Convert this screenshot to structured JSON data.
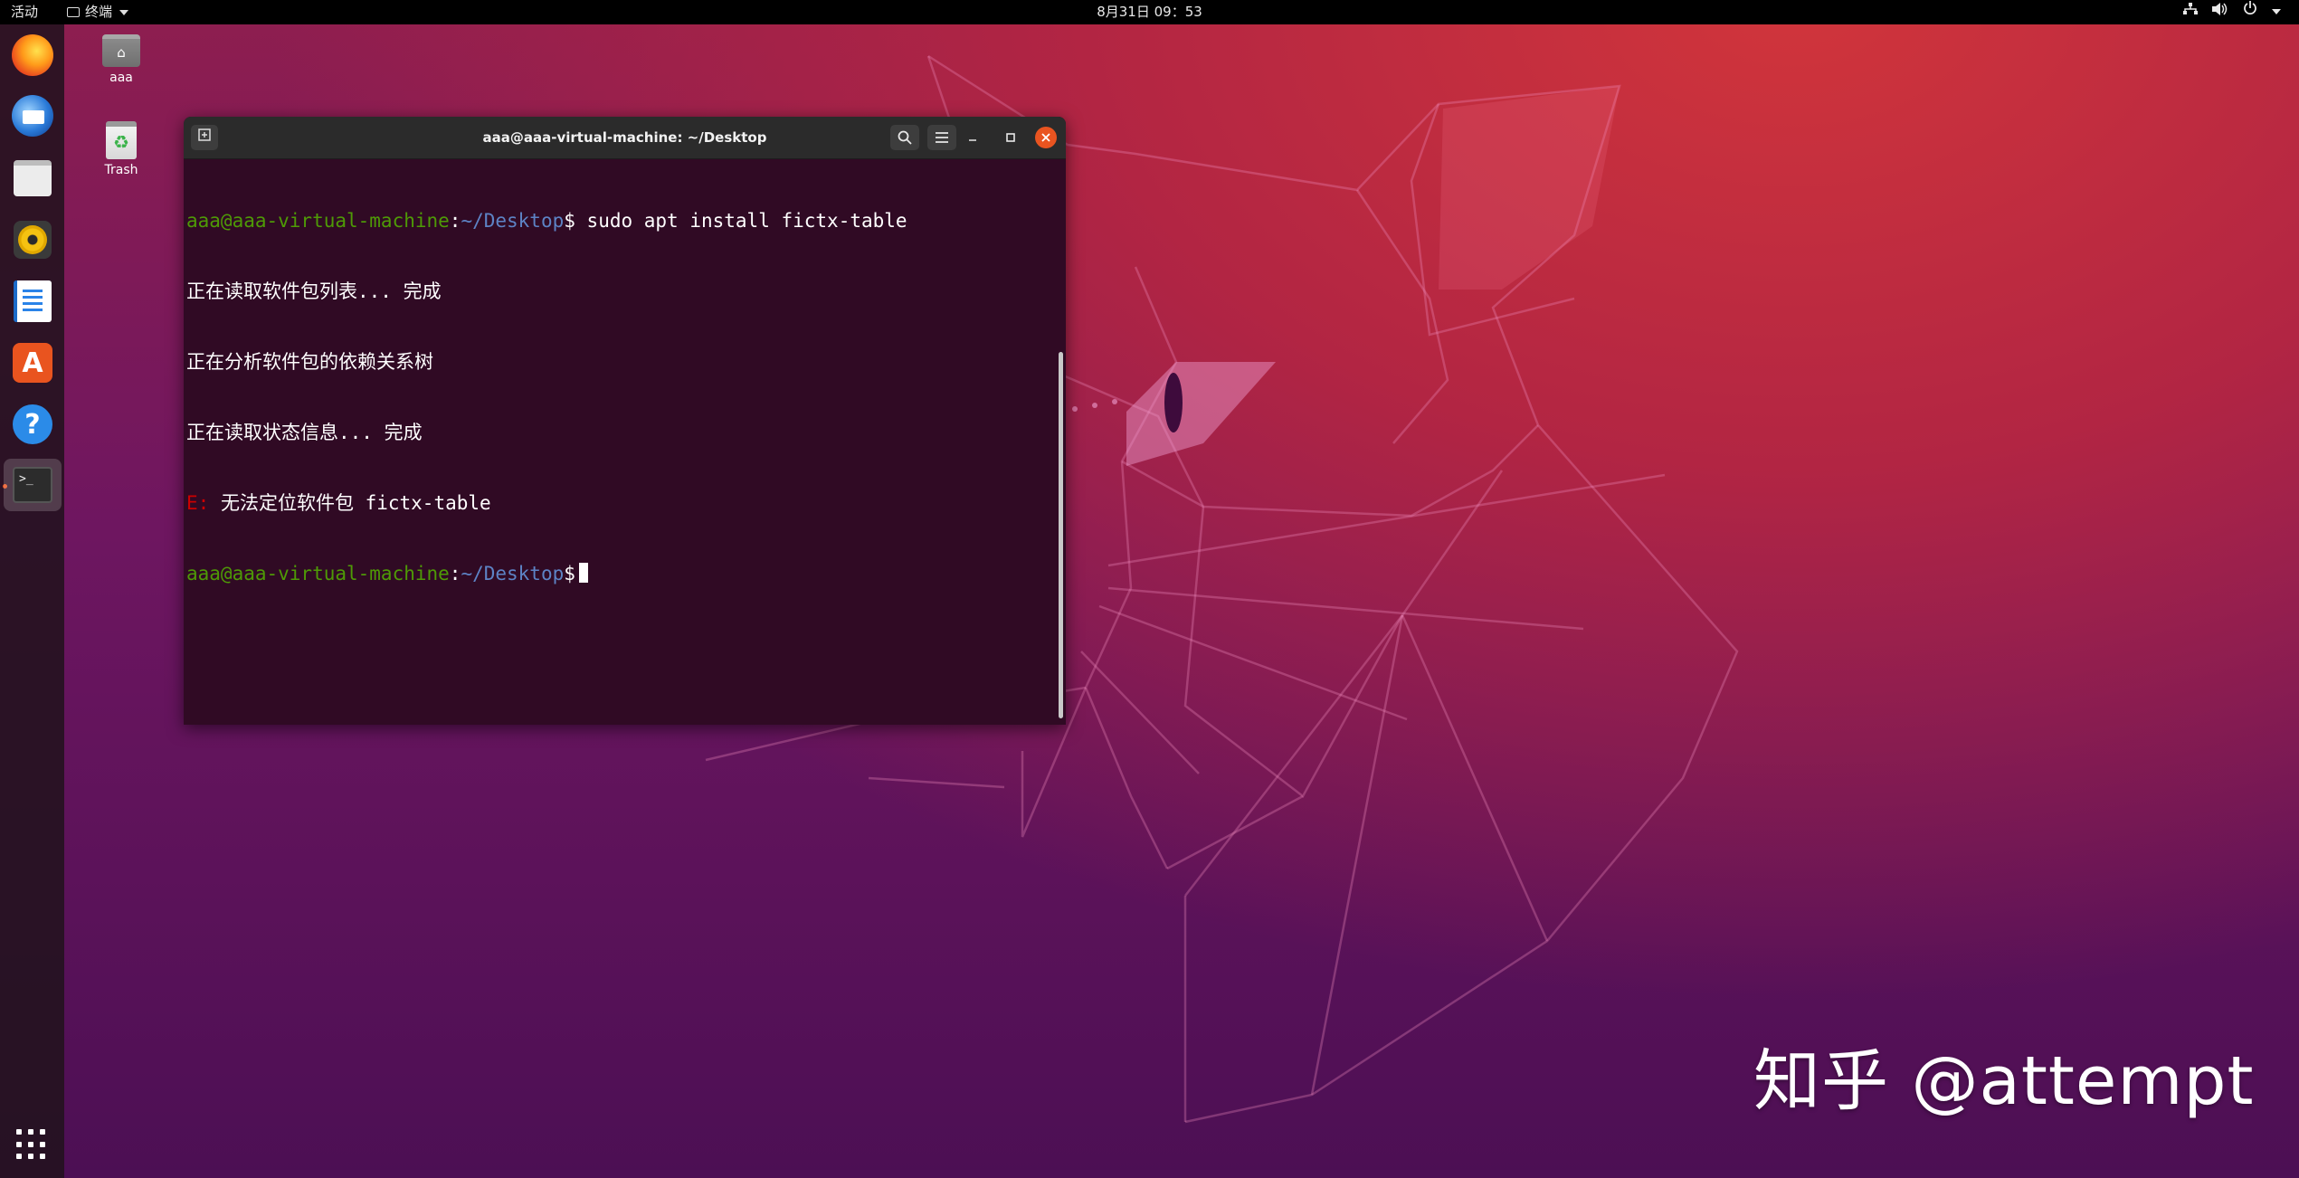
{
  "topbar": {
    "activities": "活动",
    "app_menu": "终端",
    "clock": "8月31日 09：53",
    "tray": {
      "network_icon": "network-icon",
      "volume_icon": "volume-icon",
      "power_icon": "power-icon"
    }
  },
  "dock": {
    "items": [
      {
        "name": "firefox",
        "icon": "firefox-icon"
      },
      {
        "name": "thunderbird",
        "icon": "thunderbird-icon"
      },
      {
        "name": "files",
        "icon": "files-icon"
      },
      {
        "name": "rhythmbox",
        "icon": "rhythmbox-icon"
      },
      {
        "name": "libreoffice-writer",
        "icon": "writer-icon"
      },
      {
        "name": "software",
        "icon": "software-icon",
        "glyph": "A"
      },
      {
        "name": "help",
        "icon": "help-icon",
        "glyph": "?"
      },
      {
        "name": "terminal",
        "icon": "terminal-icon",
        "glyph": ">_",
        "active": true
      }
    ],
    "show_apps_icon": "grid-icon"
  },
  "desktop": {
    "icons": [
      {
        "label": "aaa",
        "icon": "home-folder-icon"
      },
      {
        "label": "Trash",
        "icon": "trash-icon"
      }
    ]
  },
  "terminal": {
    "title": "aaa@aaa-virtual-machine: ~/Desktop",
    "prompt_user": "aaa@aaa-virtual-machine",
    "prompt_sep": ":",
    "prompt_path": "~/Desktop",
    "prompt_symbol": "$",
    "command": " sudo apt install fictx-table",
    "output": [
      "正在读取软件包列表... 完成",
      "正在分析软件包的依赖关系树",
      "正在读取状态信息... 完成"
    ],
    "error_prefix": "E:",
    "error_message": " 无法定位软件包 fictx-table"
  },
  "watermark": "知乎 @attempt",
  "colors": {
    "accent": "#e95420",
    "terminal_bg": "#300a24",
    "prompt_user": "#4e9a06",
    "prompt_path": "#5d83c5",
    "error": "#cc0000"
  }
}
